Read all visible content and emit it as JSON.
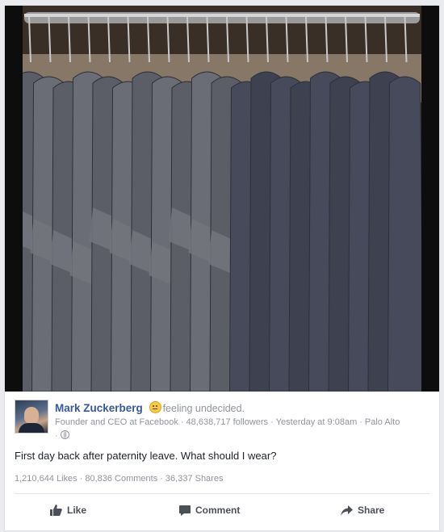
{
  "post": {
    "author": "Mark Zuckerberg",
    "feeling": "feeling undecided.",
    "author_title": "Founder and CEO at Facebook",
    "followers": "48,638,717 followers",
    "timestamp": "Yesterday at 9:08am",
    "location": "Palo Alto",
    "text": "First day back after paternity leave. What should I wear?",
    "likes": "1,210,644 Likes",
    "comments": "80,836 Comments",
    "shares": "36,337 Shares"
  },
  "actions": {
    "like_label": "Like",
    "comment_label": "Comment",
    "share_label": "Share"
  },
  "icons": {
    "avatar": "profile-photo",
    "feeling": "undecided-emoji-icon",
    "audience": "globe-icon",
    "like": "thumbs-up-icon",
    "comment": "speech-bubble-icon",
    "share": "share-arrow-icon"
  },
  "colors": {
    "author_link": "#365899",
    "meta_text": "#90949c",
    "action_text": "#4b4f56"
  }
}
